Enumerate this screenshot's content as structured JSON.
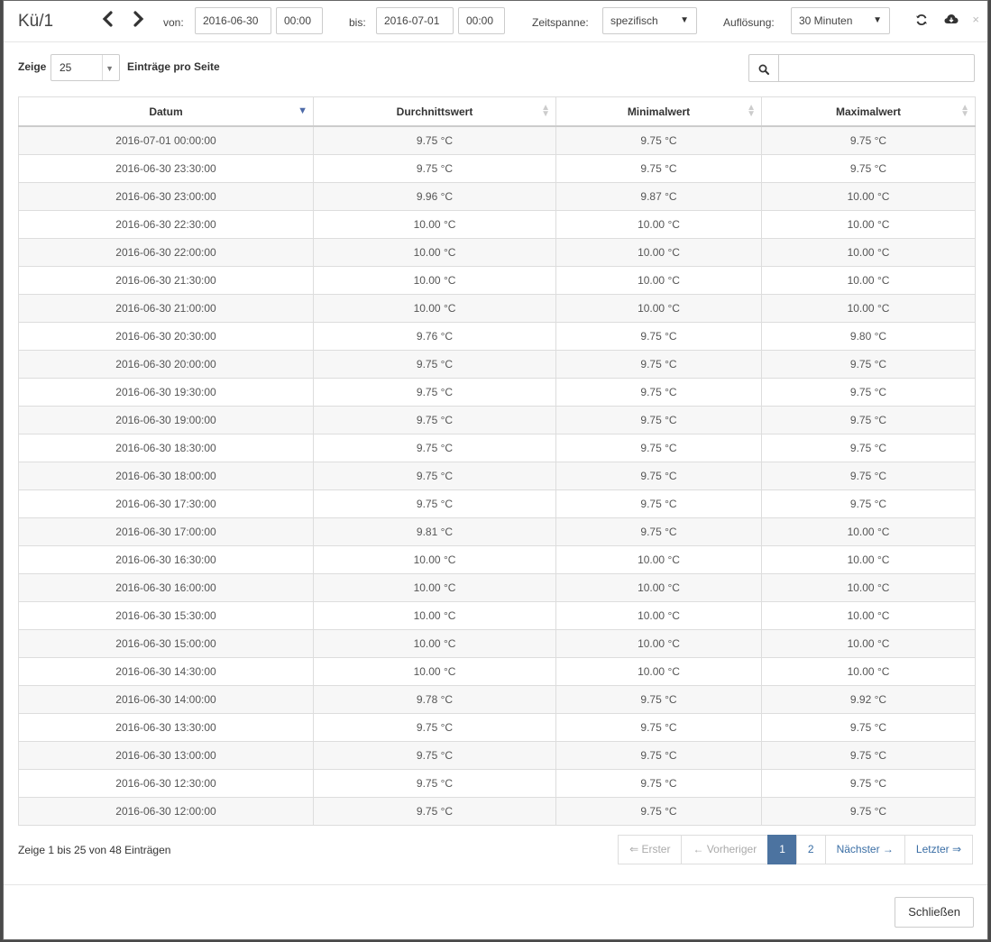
{
  "header": {
    "title": "Kü/1",
    "from_label": "von:",
    "from_date": "2016-06-30",
    "from_time": "00:00",
    "to_label": "bis:",
    "to_date": "2016-07-01",
    "to_time": "00:00",
    "range_label": "Zeitspanne:",
    "range_value": "spezifisch",
    "resolution_label": "Auflösung:",
    "resolution_value": "30 Minuten",
    "close_icon_glyph": "×"
  },
  "controls": {
    "show_label": "Zeige",
    "page_length": "25",
    "per_page_label": "Einträge pro Seite",
    "search_placeholder": ""
  },
  "table": {
    "columns": [
      "Datum",
      "Durchnittswert",
      "Minimalwert",
      "Maximalwert"
    ],
    "rows": [
      [
        "2016-07-01 00:00:00",
        "9.75 °C",
        "9.75 °C",
        "9.75 °C"
      ],
      [
        "2016-06-30 23:30:00",
        "9.75 °C",
        "9.75 °C",
        "9.75 °C"
      ],
      [
        "2016-06-30 23:00:00",
        "9.96 °C",
        "9.87 °C",
        "10.00 °C"
      ],
      [
        "2016-06-30 22:30:00",
        "10.00 °C",
        "10.00 °C",
        "10.00 °C"
      ],
      [
        "2016-06-30 22:00:00",
        "10.00 °C",
        "10.00 °C",
        "10.00 °C"
      ],
      [
        "2016-06-30 21:30:00",
        "10.00 °C",
        "10.00 °C",
        "10.00 °C"
      ],
      [
        "2016-06-30 21:00:00",
        "10.00 °C",
        "10.00 °C",
        "10.00 °C"
      ],
      [
        "2016-06-30 20:30:00",
        "9.76 °C",
        "9.75 °C",
        "9.80 °C"
      ],
      [
        "2016-06-30 20:00:00",
        "9.75 °C",
        "9.75 °C",
        "9.75 °C"
      ],
      [
        "2016-06-30 19:30:00",
        "9.75 °C",
        "9.75 °C",
        "9.75 °C"
      ],
      [
        "2016-06-30 19:00:00",
        "9.75 °C",
        "9.75 °C",
        "9.75 °C"
      ],
      [
        "2016-06-30 18:30:00",
        "9.75 °C",
        "9.75 °C",
        "9.75 °C"
      ],
      [
        "2016-06-30 18:00:00",
        "9.75 °C",
        "9.75 °C",
        "9.75 °C"
      ],
      [
        "2016-06-30 17:30:00",
        "9.75 °C",
        "9.75 °C",
        "9.75 °C"
      ],
      [
        "2016-06-30 17:00:00",
        "9.81 °C",
        "9.75 °C",
        "10.00 °C"
      ],
      [
        "2016-06-30 16:30:00",
        "10.00 °C",
        "10.00 °C",
        "10.00 °C"
      ],
      [
        "2016-06-30 16:00:00",
        "10.00 °C",
        "10.00 °C",
        "10.00 °C"
      ],
      [
        "2016-06-30 15:30:00",
        "10.00 °C",
        "10.00 °C",
        "10.00 °C"
      ],
      [
        "2016-06-30 15:00:00",
        "10.00 °C",
        "10.00 °C",
        "10.00 °C"
      ],
      [
        "2016-06-30 14:30:00",
        "10.00 °C",
        "10.00 °C",
        "10.00 °C"
      ],
      [
        "2016-06-30 14:00:00",
        "9.78 °C",
        "9.75 °C",
        "9.92 °C"
      ],
      [
        "2016-06-30 13:30:00",
        "9.75 °C",
        "9.75 °C",
        "9.75 °C"
      ],
      [
        "2016-06-30 13:00:00",
        "9.75 °C",
        "9.75 °C",
        "9.75 °C"
      ],
      [
        "2016-06-30 12:30:00",
        "9.75 °C",
        "9.75 °C",
        "9.75 °C"
      ],
      [
        "2016-06-30 12:00:00",
        "9.75 °C",
        "9.75 °C",
        "9.75 °C"
      ]
    ]
  },
  "info_text": "Zeige 1 bis 25 von 48 Einträgen",
  "pagination": {
    "first": "⇐ Erster",
    "previous": "← Vorheriger",
    "pages": [
      "1",
      "2"
    ],
    "active_page": "1",
    "next": "Nächster →",
    "last": "Letzter ⇒"
  },
  "footer": {
    "close_label": "Schließen"
  },
  "icons": {
    "prev": "chevron-left-icon",
    "next": "chevron-right-icon",
    "refresh": "refresh-icon",
    "download": "cloud-download-icon",
    "search": "search-icon"
  },
  "colors": {
    "accent": "#4c73a0",
    "link": "#3a6ea5",
    "sort_active": "#4d6aa8"
  }
}
